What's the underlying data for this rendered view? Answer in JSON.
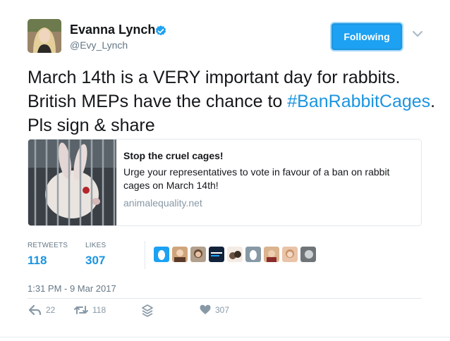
{
  "user": {
    "display_name": "Evanna Lynch",
    "handle": "@Evy_Lynch",
    "avatar_icon": "avatar-photo",
    "verified_icon": "verified-badge-icon"
  },
  "follow_button": {
    "label": "Following",
    "color": "#1da1f2"
  },
  "tweet": {
    "text_part1": "March 14th is a VERY important day for rabbits. British MEPs have the chance to ",
    "hashtag": "#BanRabbitCages",
    "text_part2": ". Pls sign & share"
  },
  "card": {
    "title": "Stop the cruel cages!",
    "description": "Urge your representatives to vote in favour of a ban on rabbit cages on March 14th!",
    "domain": "animalequality.net",
    "image_icon": "caged-rabbit-photo"
  },
  "stats": {
    "retweets_label": "RETWEETS",
    "retweets_value": "118",
    "likes_label": "LIKES",
    "likes_value": "307"
  },
  "timestamp": "1:31 PM - 9 Mar 2017",
  "actions": {
    "reply_count": "22",
    "retweet_count": "118",
    "like_count": "307",
    "reply_icon": "reply-icon",
    "retweet_icon": "retweet-icon",
    "stack_icon": "stack-icon",
    "like_icon": "heart-icon"
  },
  "colors": {
    "accent": "#1b95e0",
    "muted": "#657786",
    "border": "#e1e8ed"
  }
}
